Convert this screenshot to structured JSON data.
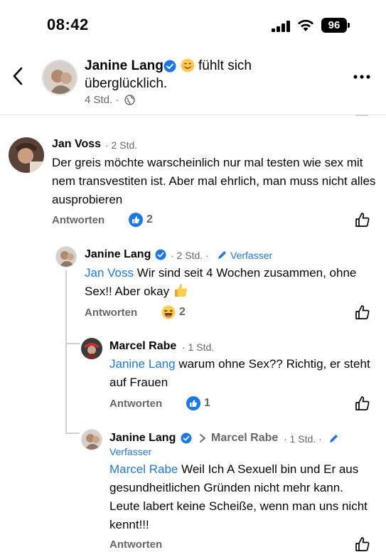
{
  "status_bar": {
    "time": "08:42",
    "battery": "96"
  },
  "post_header": {
    "author": "Janine Lang",
    "feeling_line1": "fühlt sich",
    "feeling_line2": "überglücklich.",
    "meta": "4 Std. ·"
  },
  "comments": [
    {
      "author": "Jan Voss",
      "time": "· 2 Std.",
      "text": "Der greis möchte warscheinlich nur mal testen wie sex mit nem transvestiten ist. Aber mal ehrlich, man muss nicht alles ausprobieren",
      "reply_label": "Antworten",
      "reaction_count": "2"
    },
    {
      "author": "Janine Lang",
      "time": "· 2 Std. ·",
      "author_tag": "Verfasser",
      "mention": "Jan Voss",
      "text": " Wir sind seit 4 Wochen zusammen, ohne Sex!! Aber okay",
      "reply_label": "Antworten",
      "reaction_count": "2"
    },
    {
      "author": "Marcel Rabe",
      "time": "· 1 Std.",
      "mention": "Janine Lang",
      "text": " warum ohne Sex?? Richtig, er steht auf Frauen",
      "reply_label": "Antworten",
      "reaction_count": "1"
    },
    {
      "author": "Janine Lang",
      "reply_to": "Marcel Rabe",
      "time": "· 1 Std. ·",
      "author_tag": "Verfasser",
      "mention": "Marcel Rabe",
      "text": " Weil Ich A Sexuell bin und Er aus gesundheitlichen Gründen nicht mehr kann. Leute labert keine Scheiße, wenn man uns nicht kennt!!!",
      "reply_label": "Antworten"
    }
  ],
  "colors": {
    "link": "#1877f2",
    "muted": "#65676b",
    "like_blue": "#1877f2"
  }
}
